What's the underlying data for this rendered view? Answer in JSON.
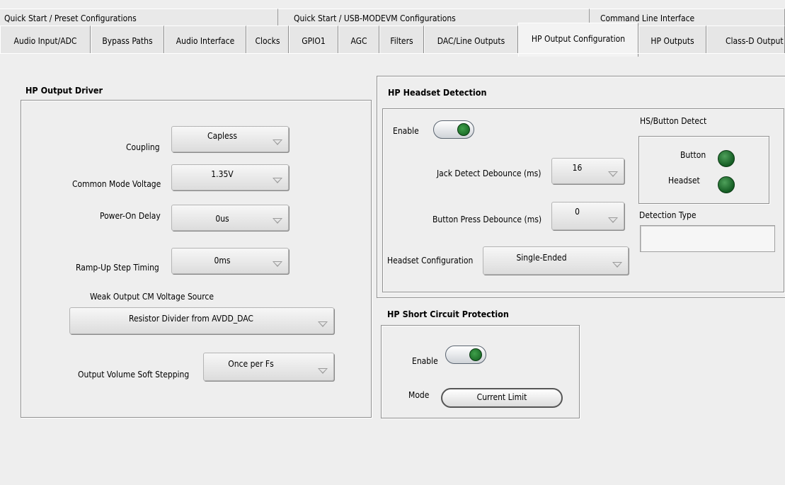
{
  "tabs_row1": [
    {
      "label": "Quick Start / Preset Configurations"
    },
    {
      "label": "Quick Start / USB-MODEVM Configurations"
    },
    {
      "label": "Command Line Interface"
    }
  ],
  "tabs_row2": [
    {
      "label": "Audio Input/ADC"
    },
    {
      "label": "Bypass Paths"
    },
    {
      "label": "Audio Interface"
    },
    {
      "label": "Clocks"
    },
    {
      "label": "GPIO1"
    },
    {
      "label": "AGC"
    },
    {
      "label": "Filters"
    },
    {
      "label": "DAC/Line Outputs"
    },
    {
      "label": "HP Output Configuration"
    },
    {
      "label": "HP Outputs"
    },
    {
      "label": "Class-D Output"
    }
  ],
  "active_tab": "HP Output Configuration",
  "hp_output_driver": {
    "title": "HP Output Driver",
    "coupling_label": "Coupling",
    "coupling_value": "Capless",
    "cm_voltage_label": "Common Mode Voltage",
    "cm_voltage_value": "1.35V",
    "power_on_delay_label": "Power-On Delay",
    "power_on_delay_value": "0us",
    "ramp_up_label": "Ramp-Up Step Timing",
    "ramp_up_value": "0ms",
    "weak_cm_label": "Weak Output CM Voltage Source",
    "weak_cm_value": "Resistor Divider from AVDD_DAC",
    "soft_step_label": "Output Volume Soft Stepping",
    "soft_step_value": "Once per Fs"
  },
  "hp_headset_detection": {
    "title": "HP Headset Detection",
    "enable_label": "Enable",
    "jack_debounce_label": "Jack Detect Debounce (ms)",
    "jack_debounce_value": "16",
    "button_debounce_label": "Button Press Debounce (ms)",
    "button_debounce_value": "0",
    "headset_config_label": "Headset Configuration",
    "headset_config_value": "Single-Ended",
    "hs_button_detect_label": "HS/Button Detect",
    "button_led_label": "Button",
    "headset_led_label": "Headset",
    "detection_type_label": "Detection Type",
    "detection_type_value": ""
  },
  "hp_short_circuit": {
    "title": "HP Short Circuit Protection",
    "enable_label": "Enable",
    "mode_label": "Mode",
    "mode_value": "Current Limit"
  },
  "colors": {
    "background": "#eeeeee",
    "led_green": "#1f7a30",
    "toggle_knob": "#1f7a30"
  }
}
